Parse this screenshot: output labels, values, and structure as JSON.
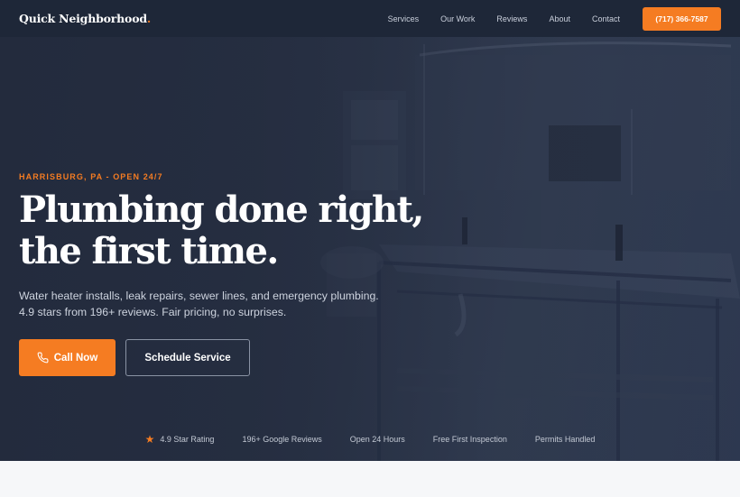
{
  "nav": {
    "logo_text": "Quick Neighborhood",
    "logo_dot": ".",
    "links": [
      "Services",
      "Our Work",
      "Reviews",
      "About",
      "Contact"
    ],
    "phone_cta": "(717) 366-7587"
  },
  "hero": {
    "eyebrow": "HARRISBURG, PA - OPEN 24/7",
    "headline_line1": "Plumbing done right,",
    "headline_line2": "the first time.",
    "subtext_line1": "Water heater installs, leak repairs, sewer lines, and emergency plumbing.",
    "subtext_line2": "4.9 stars from 196+ reviews. Fair pricing, no surprises.",
    "primary_button": "Call Now",
    "secondary_button": "Schedule Service"
  },
  "trust": {
    "items": [
      "4.9 Star Rating",
      "196+ Google Reviews",
      "Open 24 Hours",
      "Free First Inspection",
      "Permits Handled"
    ]
  },
  "colors": {
    "accent": "#f57c22",
    "nav_bg": "#1e2738",
    "hero_overlay": "#222a3c"
  },
  "icons": {
    "phone": "phone-icon",
    "star": "star-icon"
  }
}
